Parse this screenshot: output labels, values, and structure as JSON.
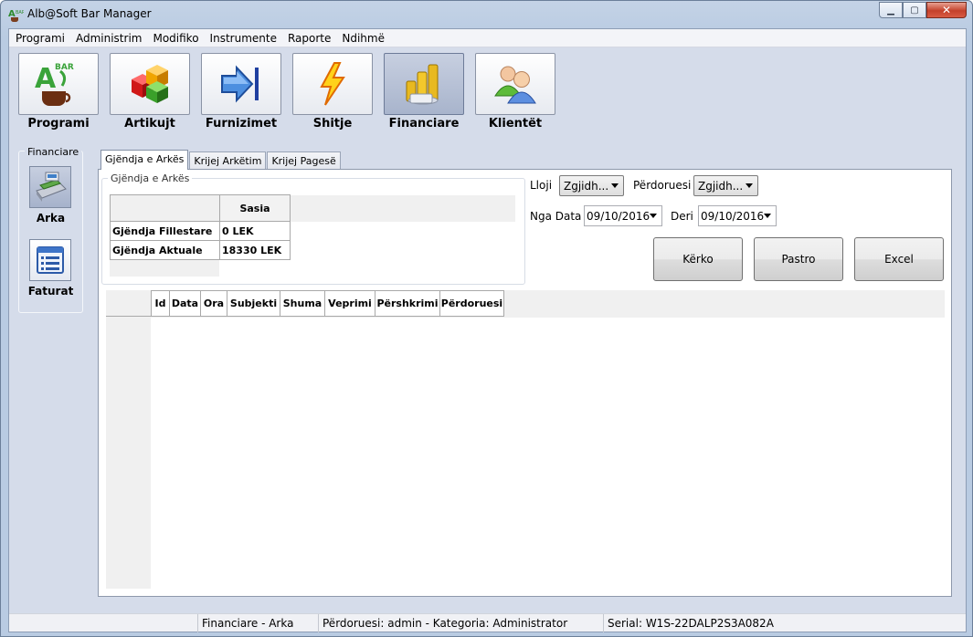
{
  "window": {
    "title": "Alb@Soft Bar Manager"
  },
  "menu": [
    "Programi",
    "Administrim",
    "Modifiko",
    "Instrumente",
    "Raporte",
    "Ndihmë"
  ],
  "toolbar": [
    {
      "label": "Programi",
      "icon": "coffee-cup-logo-icon"
    },
    {
      "label": "Artikujt",
      "icon": "colored-cubes-icon"
    },
    {
      "label": "Furnizimet",
      "icon": "import-arrow-icon"
    },
    {
      "label": "Shitje",
      "icon": "lightning-bolt-icon"
    },
    {
      "label": "Financiare",
      "icon": "coins-stack-icon",
      "active": true
    },
    {
      "label": "Klientët",
      "icon": "users-icon"
    }
  ],
  "side": {
    "title": "Financiare",
    "items": [
      {
        "label": "Arka",
        "icon": "cash-register-icon",
        "active": true
      },
      {
        "label": "Faturat",
        "icon": "invoice-list-icon"
      }
    ]
  },
  "tabs": [
    "Gjëndja e Arkës",
    "Krijej Arkëtim",
    "Krijej Pagesë"
  ],
  "balance": {
    "legend": "Gjëndja e Arkës",
    "column": "Sasia",
    "rows": [
      {
        "label": "Gjëndja Fillestare",
        "value": "0 LEK"
      },
      {
        "label": "Gjëndja Aktuale",
        "value": "18330 LEK"
      }
    ]
  },
  "filters": {
    "type_label": "Lloji",
    "type_value": "Zgjidh...",
    "user_label": "Përdoruesi",
    "user_value": "Zgjidh...",
    "from_label": "Nga Data",
    "from_value": "09/10/2016",
    "to_label": "Deri",
    "to_value": "09/10/2016"
  },
  "buttons": {
    "search": "Kërko",
    "clear": "Pastro",
    "excel": "Excel"
  },
  "grid": {
    "columns": [
      "Id",
      "Data",
      "Ora",
      "Subjekti",
      "Shuma",
      "Veprimi",
      "Përshkrimi",
      "Përdoruesi"
    ]
  },
  "status": {
    "module": "Financiare - Arka",
    "user": "Përdoruesi: admin - Kategoria: Administrator",
    "serial": "Serial: W1S-22DALP2S3A082A"
  }
}
